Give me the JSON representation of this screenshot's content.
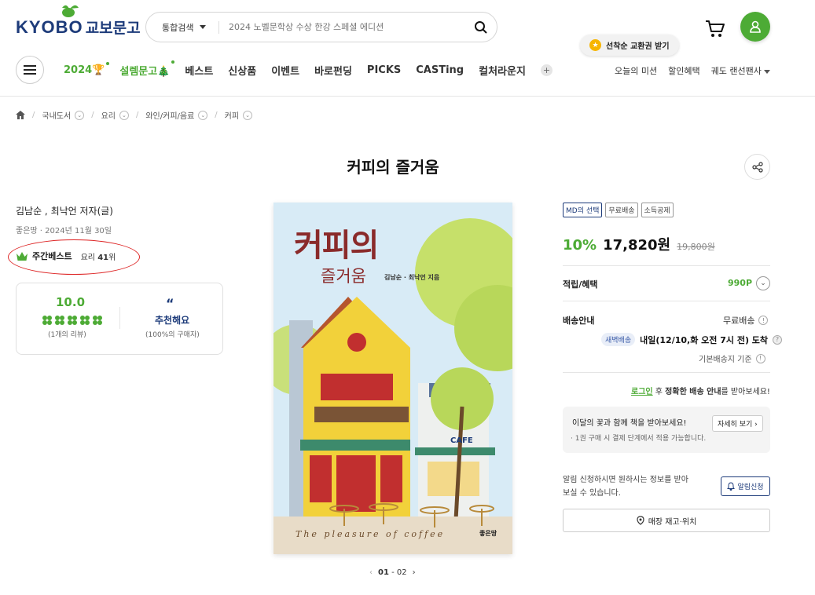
{
  "header": {
    "logo_en": "KYOBO",
    "logo_ko": "교보문고",
    "search_category": "통합검색",
    "search_placeholder": "2024 노벨문학상 수상 한강 스페셜 에디션",
    "tooltip": "선착순 교환권 받기"
  },
  "nav": {
    "items": [
      "2024",
      "설렘문고",
      "베스트",
      "신상품",
      "이벤트",
      "바로펀딩",
      "PICKS",
      "CASTing",
      "컬처라운지"
    ],
    "plus": "+",
    "right": [
      "오늘의 미션",
      "할인혜택",
      "궤도 랜선팬사"
    ]
  },
  "breadcrumb": [
    "국내도서",
    "요리",
    "와인/커피/음료",
    "커피"
  ],
  "book": {
    "title": "커피의 즐거움",
    "authors": "김남순 , 최낙언 저자(글)",
    "publisher_date": "좋은땅 · 2024년 11월 30일",
    "best_label": "주간베스트",
    "best_cat": "요리",
    "best_rank": "41",
    "best_unit": "위"
  },
  "review": {
    "score": "10.0",
    "count": "(1개의 리뷰)",
    "quote": "“",
    "recommend": "추천해요",
    "pct": "(100%의 구매자)"
  },
  "cover": {
    "title_main": "커피의",
    "title_sub": "즐거움",
    "author": "김남순 · 최낙언 지음",
    "english": "The pleasure of coffee",
    "publisher": "좋은땅",
    "sign": "CAFE"
  },
  "pager": {
    "current": "01",
    "sep": " - ",
    "total": "02"
  },
  "product": {
    "badges": [
      "MD의 선택",
      "무료배송",
      "소득공제"
    ],
    "discount": "10%",
    "price": "17,820원",
    "original": "19,800원",
    "points_label": "적립/혜택",
    "points_value": "990P",
    "ship_label": "배송안내",
    "ship_free": "무료배송",
    "dawn_badge": "새벽배송",
    "ship_date": "내일(12/10,화 오전 7시 전) 도착",
    "ship_base": "기본배송지 기준",
    "login_link": "로그인",
    "login_mid": " 후 ",
    "login_bold": "정확한 배송 안내",
    "login_end": "를 받아보세요!",
    "promo_title": "이달의 꽃과 함께 책을 받아보세요!",
    "promo_sub": "· 1권 구매 시 결제 단계에서 적용 가능합니다.",
    "promo_btn": "자세히 보기",
    "alert_text": "알림 신청하시면 원하시는 정보를 받아 보실 수 있습니다.",
    "alert_btn": "알림신청",
    "store_btn": "매장 재고·위치"
  },
  "colors": {
    "brand_green": "#4dab35",
    "brand_navy": "#1d3b7a",
    "annotation_red": "#dd2222"
  }
}
